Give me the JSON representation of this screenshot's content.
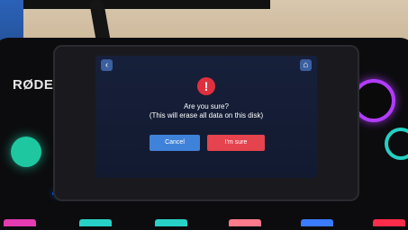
{
  "brand": {
    "name": "RØDE"
  },
  "screen": {
    "nav": {
      "back_icon": "chevron-left-icon",
      "home_icon": "home-icon"
    },
    "dialog": {
      "icon": "alert-icon",
      "title": "Are you sure?",
      "subtitle": "(This will erase all data on this disk)",
      "cancel_label": "Cancel",
      "confirm_label": "I'm sure"
    }
  },
  "colors": {
    "cancel": "#3f82d9",
    "confirm": "#e5434e",
    "alert": "#e0303d",
    "screen_bg": "#17203a"
  }
}
